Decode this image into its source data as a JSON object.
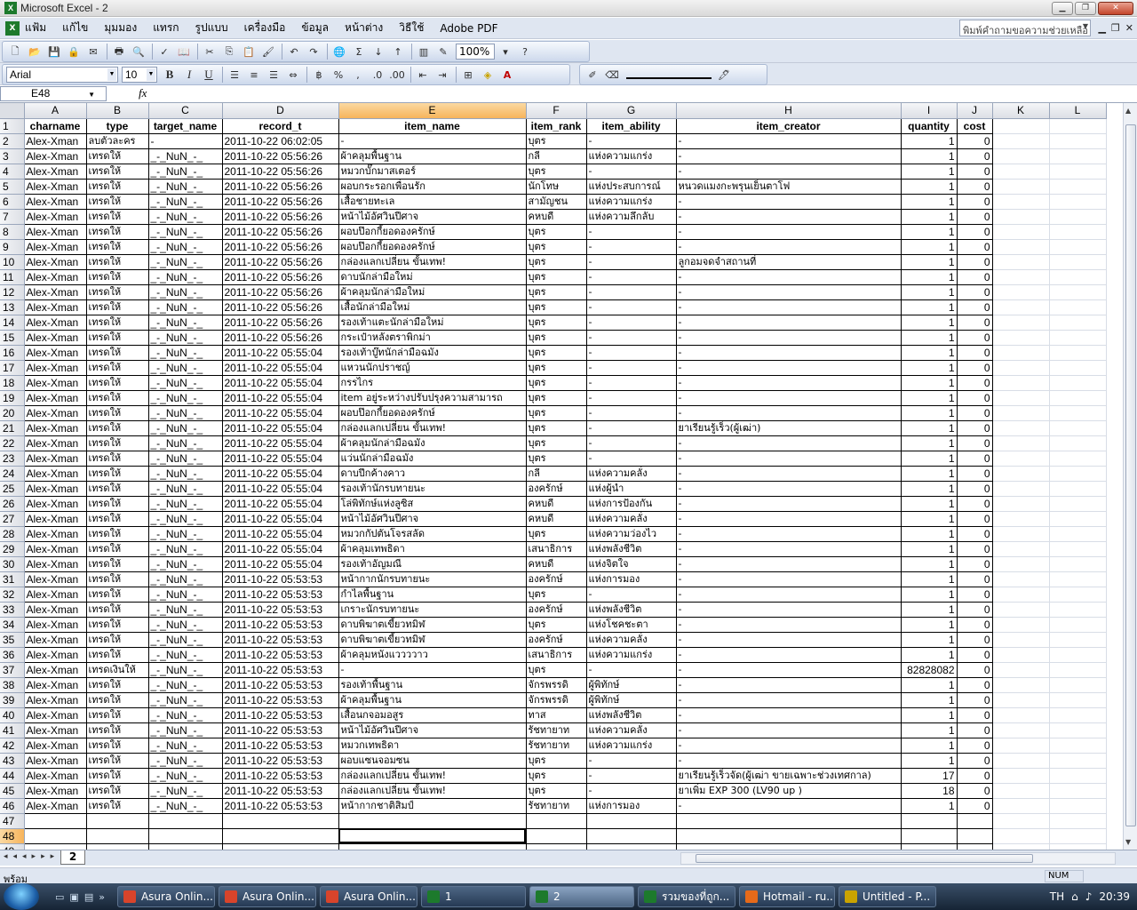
{
  "window": {
    "title": "Microsoft Excel - 2"
  },
  "menu": {
    "items": [
      "แฟ้ม",
      "แก้ไข",
      "มุมมอง",
      "แทรก",
      "รูปแบบ",
      "เครื่องมือ",
      "ข้อมูล",
      "หน้าต่าง",
      "วิธีใช้",
      "Adobe PDF"
    ],
    "help_placeholder": "พิมพ์คำถามขอความช่วยเหลือ"
  },
  "toolbar": {
    "zoom": "100%",
    "font": "Arial",
    "font_size": "10"
  },
  "formula_bar": {
    "name_box": "E48",
    "fx": "fx",
    "content": ""
  },
  "grid": {
    "columns": [
      "A",
      "B",
      "C",
      "D",
      "E",
      "F",
      "G",
      "H",
      "I",
      "J",
      "K",
      "L"
    ],
    "selected_column": "E",
    "selected_row": 48,
    "headers": [
      "charname",
      "type",
      "target_name",
      "record_t",
      "item_name",
      "item_rank",
      "item_ability",
      "item_creator",
      "quantity",
      "cost"
    ],
    "rows": [
      [
        "Alex-Xman",
        "ลบตัวละคร",
        "-",
        "2011-10-22 06:02:05",
        "-",
        "บุตร",
        "-",
        "-",
        "1",
        "0"
      ],
      [
        "Alex-Xman",
        "เทรดให้",
        "_-_NuN_-_",
        "2011-10-22 05:56:26",
        "ผ้าคลุมพื้นฐาน",
        "กลี",
        "แห่งความแกร่ง",
        "-",
        "1",
        "0"
      ],
      [
        "Alex-Xman",
        "เทรดให้",
        "_-_NuN_-_",
        "2011-10-22 05:56:26",
        "หมวกบั๊กมาสเตอร์",
        "บุตร",
        "-",
        "-",
        "1",
        "0"
      ],
      [
        "Alex-Xman",
        "เทรดให้",
        "_-_NuN_-_",
        "2011-10-22 05:56:26",
        "ผอบกระรอกเพื่อนรัก",
        "นักโทษ",
        "แห่งประสบการณ์",
        "หนวดแมงกะพรุนเย็นตาโฟ",
        "1",
        "0"
      ],
      [
        "Alex-Xman",
        "เทรดให้",
        "_-_NuN_-_",
        "2011-10-22 05:56:26",
        "เสื้อชายทะเล",
        "สามัญชน",
        "แห่งความแกร่ง",
        "-",
        "1",
        "0"
      ],
      [
        "Alex-Xman",
        "เทรดให้",
        "_-_NuN_-_",
        "2011-10-22 05:56:26",
        "หน้าไม้อัศวินปีศาจ",
        "คหบดี",
        "แห่งความลึกลับ",
        "-",
        "1",
        "0"
      ],
      [
        "Alex-Xman",
        "เทรดให้",
        "_-_NuN_-_",
        "2011-10-22 05:56:26",
        "ผอบป๊อกกี้ยอดองครักษ์",
        "บุตร",
        "-",
        "-",
        "1",
        "0"
      ],
      [
        "Alex-Xman",
        "เทรดให้",
        "_-_NuN_-_",
        "2011-10-22 05:56:26",
        "ผอบป๊อกกี้ยอดองครักษ์",
        "บุตร",
        "-",
        "-",
        "1",
        "0"
      ],
      [
        "Alex-Xman",
        "เทรดให้",
        "_-_NuN_-_",
        "2011-10-22 05:56:26",
        "กล่องแลกเปลี่ยน ขั้นเทพ!",
        "บุตร",
        "-",
        "ลูกอมจดจำสถานที่",
        "1",
        "0"
      ],
      [
        "Alex-Xman",
        "เทรดให้",
        "_-_NuN_-_",
        "2011-10-22 05:56:26",
        "ดาบนักล่ามือใหม่",
        "บุตร",
        "-",
        "-",
        "1",
        "0"
      ],
      [
        "Alex-Xman",
        "เทรดให้",
        "_-_NuN_-_",
        "2011-10-22 05:56:26",
        "ผ้าคลุมนักล่ามือใหม่",
        "บุตร",
        "-",
        "-",
        "1",
        "0"
      ],
      [
        "Alex-Xman",
        "เทรดให้",
        "_-_NuN_-_",
        "2011-10-22 05:56:26",
        "เสื้อนักล่ามือใหม่",
        "บุตร",
        "-",
        "-",
        "1",
        "0"
      ],
      [
        "Alex-Xman",
        "เทรดให้",
        "_-_NuN_-_",
        "2011-10-22 05:56:26",
        "รองเท้าแตะนักล่ามือใหม่",
        "บุตร",
        "-",
        "-",
        "1",
        "0"
      ],
      [
        "Alex-Xman",
        "เทรดให้",
        "_-_NuN_-_",
        "2011-10-22 05:56:26",
        "กระเป๋าหลังตราพิกม่า",
        "บุตร",
        "-",
        "-",
        "1",
        "0"
      ],
      [
        "Alex-Xman",
        "เทรดให้",
        "_-_NuN_-_",
        "2011-10-22 05:55:04",
        "รองเท้าบู๊ทนักล่ามือฉมัง",
        "บุตร",
        "-",
        "-",
        "1",
        "0"
      ],
      [
        "Alex-Xman",
        "เทรดให้",
        "_-_NuN_-_",
        "2011-10-22 05:55:04",
        "แหวนนักปราชญ์",
        "บุตร",
        "-",
        "-",
        "1",
        "0"
      ],
      [
        "Alex-Xman",
        "เทรดให้",
        "_-_NuN_-_",
        "2011-10-22 05:55:04",
        "กรรไกร",
        "บุตร",
        "-",
        "-",
        "1",
        "0"
      ],
      [
        "Alex-Xman",
        "เทรดให้",
        "_-_NuN_-_",
        "2011-10-22 05:55:04",
        "item อยู่ระหว่างปรับปรุงความสามารถ",
        "บุตร",
        "-",
        "-",
        "1",
        "0"
      ],
      [
        "Alex-Xman",
        "เทรดให้",
        "_-_NuN_-_",
        "2011-10-22 05:55:04",
        "ผอบป๊อกกี้ยอดองครักษ์",
        "บุตร",
        "-",
        "-",
        "1",
        "0"
      ],
      [
        "Alex-Xman",
        "เทรดให้",
        "_-_NuN_-_",
        "2011-10-22 05:55:04",
        "กล่องแลกเปลี่ยน ขั้นเทพ!",
        "บุตร",
        "-",
        "ยาเรียนรู้เร็ว(ผู้เฒ่า)",
        "1",
        "0"
      ],
      [
        "Alex-Xman",
        "เทรดให้",
        "_-_NuN_-_",
        "2011-10-22 05:55:04",
        "ผ้าคลุมนักล่ามือฉมัง",
        "บุตร",
        "-",
        "-",
        "1",
        "0"
      ],
      [
        "Alex-Xman",
        "เทรดให้",
        "_-_NuN_-_",
        "2011-10-22 05:55:04",
        "แว่นนักล่ามือฉมัง",
        "บุตร",
        "-",
        "-",
        "1",
        "0"
      ],
      [
        "Alex-Xman",
        "เทรดให้",
        "_-_NuN_-_",
        "2011-10-22 05:55:04",
        "ดาบปีกค้างคาว",
        "กลี",
        "แห่งความคลั่ง",
        "-",
        "1",
        "0"
      ],
      [
        "Alex-Xman",
        "เทรดให้",
        "_-_NuN_-_",
        "2011-10-22 05:55:04",
        "รองเท้านักรบทายนะ",
        "องครักษ์",
        "แห่งผู้นำ",
        "-",
        "1",
        "0"
      ],
      [
        "Alex-Xman",
        "เทรดให้",
        "_-_NuN_-_",
        "2011-10-22 05:55:04",
        "โล่พิทักษ์แห่งลูซิส",
        "คหบดี",
        "แห่งการป้องกัน",
        "-",
        "1",
        "0"
      ],
      [
        "Alex-Xman",
        "เทรดให้",
        "_-_NuN_-_",
        "2011-10-22 05:55:04",
        "หน้าไม้อัศวินปีศาจ",
        "คหบดี",
        "แห่งความคลั่ง",
        "-",
        "1",
        "0"
      ],
      [
        "Alex-Xman",
        "เทรดให้",
        "_-_NuN_-_",
        "2011-10-22 05:55:04",
        "หมวกกัปตันโจรสลัด",
        "บุตร",
        "แห่งความว่องไว",
        "-",
        "1",
        "0"
      ],
      [
        "Alex-Xman",
        "เทรดให้",
        "_-_NuN_-_",
        "2011-10-22 05:55:04",
        "ผ้าคลุมเทพธิดา",
        "เสนาธิการ",
        "แห่งพลังชีวิต",
        "-",
        "1",
        "0"
      ],
      [
        "Alex-Xman",
        "เทรดให้",
        "_-_NuN_-_",
        "2011-10-22 05:55:04",
        "รองเท้าอัญมณี",
        "คหบดี",
        "แห่งจิตใจ",
        "-",
        "1",
        "0"
      ],
      [
        "Alex-Xman",
        "เทรดให้",
        "_-_NuN_-_",
        "2011-10-22 05:53:53",
        "หน้ากากนักรบทายนะ",
        "องครักษ์",
        "แห่งการมอง",
        "-",
        "1",
        "0"
      ],
      [
        "Alex-Xman",
        "เทรดให้",
        "_-_NuN_-_",
        "2011-10-22 05:53:53",
        "กำไลพื้นฐาน",
        "บุตร",
        "-",
        "-",
        "1",
        "0"
      ],
      [
        "Alex-Xman",
        "เทรดให้",
        "_-_NuN_-_",
        "2011-10-22 05:53:53",
        "เกราะนักรบทายนะ",
        "องครักษ์",
        "แห่งพลังชีวิต",
        "-",
        "1",
        "0"
      ],
      [
        "Alex-Xman",
        "เทรดให้",
        "_-_NuN_-_",
        "2011-10-22 05:53:53",
        "ดาบพิฆาตเขี้ยวทมิฬ",
        "บุตร",
        "แห่งโชคชะตา",
        "-",
        "1",
        "0"
      ],
      [
        "Alex-Xman",
        "เทรดให้",
        "_-_NuN_-_",
        "2011-10-22 05:53:53",
        "ดาบพิฆาตเขี้ยวทมิฬ",
        "องครักษ์",
        "แห่งความคลั่ง",
        "-",
        "1",
        "0"
      ],
      [
        "Alex-Xman",
        "เทรดให้",
        "_-_NuN_-_",
        "2011-10-22 05:53:53",
        "ผ้าคลุมหนังแววววาว",
        "เสนาธิการ",
        "แห่งความแกร่ง",
        "-",
        "1",
        "0"
      ],
      [
        "Alex-Xman",
        "เทรดเงินให้",
        "_-_NuN_-_",
        "2011-10-22 05:53:53",
        "-",
        "บุตร",
        "-",
        "-",
        "82828082",
        "0"
      ],
      [
        "Alex-Xman",
        "เทรดให้",
        "_-_NuN_-_",
        "2011-10-22 05:53:53",
        "รองเท้าพื้นฐาน",
        "จักรพรรดิ",
        "ผู้พิทักษ์",
        "-",
        "1",
        "0"
      ],
      [
        "Alex-Xman",
        "เทรดให้",
        "_-_NuN_-_",
        "2011-10-22 05:53:53",
        "ผ้าคลุมพื้นฐาน",
        "จักรพรรดิ",
        "ผู้พิทักษ์",
        "-",
        "1",
        "0"
      ],
      [
        "Alex-Xman",
        "เทรดให้",
        "_-_NuN_-_",
        "2011-10-22 05:53:53",
        "เสื้อนกจอมอสูร",
        "ทาส",
        "แห่งพลังชีวิต",
        "-",
        "1",
        "0"
      ],
      [
        "Alex-Xman",
        "เทรดให้",
        "_-_NuN_-_",
        "2011-10-22 05:53:53",
        "หน้าไม้อัศวินปีศาจ",
        "รัชทายาท",
        "แห่งความคลั่ง",
        "-",
        "1",
        "0"
      ],
      [
        "Alex-Xman",
        "เทรดให้",
        "_-_NuN_-_",
        "2011-10-22 05:53:53",
        "หมวกเทพธิดา",
        "รัชทายาท",
        "แห่งความแกร่ง",
        "-",
        "1",
        "0"
      ],
      [
        "Alex-Xman",
        "เทรดให้",
        "_-_NuN_-_",
        "2011-10-22 05:53:53",
        "ผอบแซนจอมซน",
        "บุตร",
        "-",
        "-",
        "1",
        "0"
      ],
      [
        "Alex-Xman",
        "เทรดให้",
        "_-_NuN_-_",
        "2011-10-22 05:53:53",
        "กล่องแลกเปลี่ยน ขั้นเทพ!",
        "บุตร",
        "-",
        "ยาเรียนรู้เร็วจัด(ผู้เฒ่า ขายเฉพาะช่วงเทศกาล)",
        "17",
        "0"
      ],
      [
        "Alex-Xman",
        "เทรดให้",
        "_-_NuN_-_",
        "2011-10-22 05:53:53",
        "กล่องแลกเปลี่ยน ขั้นเทพ!",
        "บุตร",
        "-",
        "ยาเพิ่ม EXP 300 (LV90 up )",
        "18",
        "0"
      ],
      [
        "Alex-Xman",
        "เทรดให้",
        "_-_NuN_-_",
        "2011-10-22 05:53:53",
        "หน้ากากชาติสิมป์",
        "รัชทายาท",
        "แห่งการมอง",
        "-",
        "1",
        "0"
      ]
    ],
    "extra_rows": [
      47,
      48,
      49
    ]
  },
  "sheet": {
    "tab": "2"
  },
  "status": {
    "text": "พร้อม",
    "num": "NUM"
  },
  "taskbar": {
    "tasks": [
      "Asura Onlin...",
      "Asura Onlin...",
      "Asura Onlin...",
      "1",
      "2",
      "รวมของที่ถูก...",
      "Hotmail - ru...",
      "Untitled - P..."
    ],
    "lang": "TH",
    "clock": "20:39"
  }
}
